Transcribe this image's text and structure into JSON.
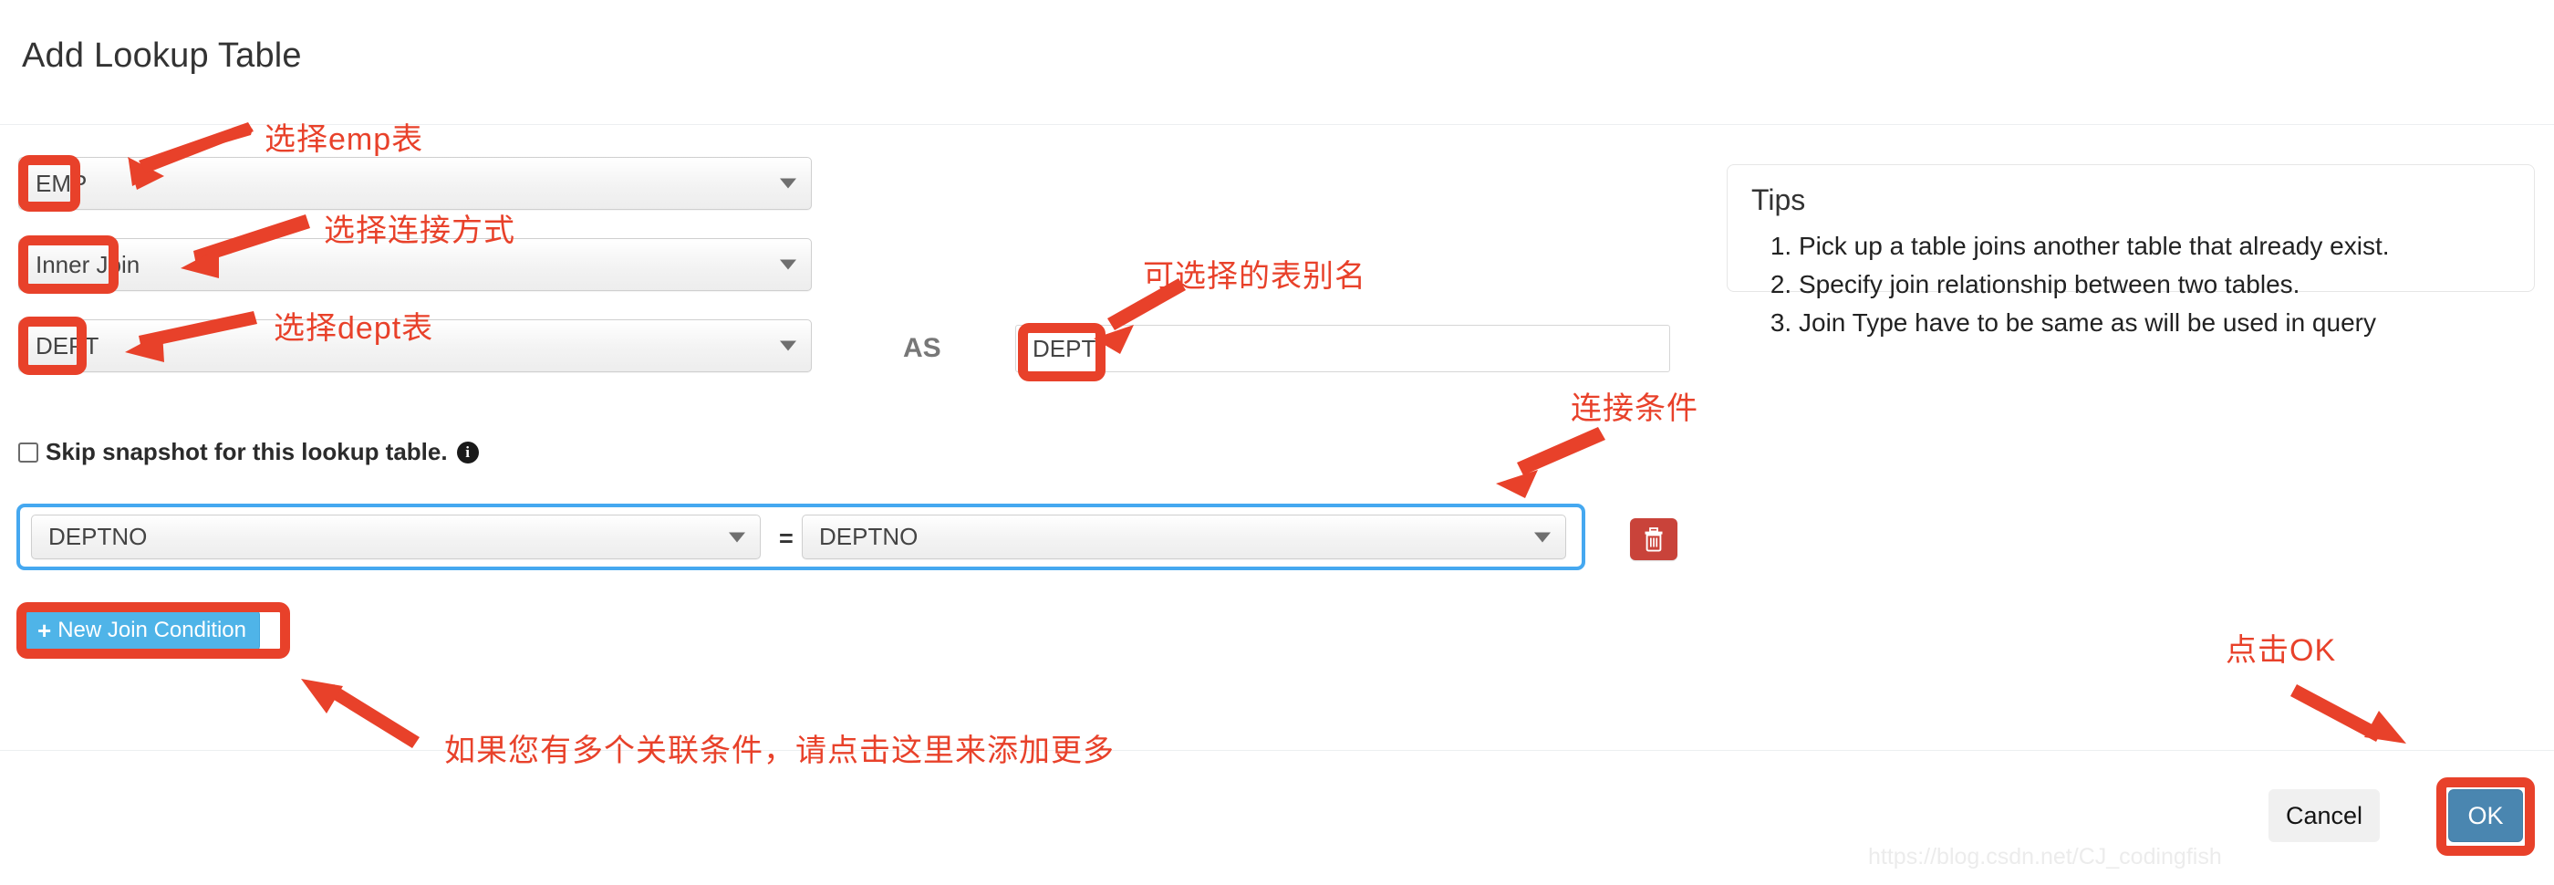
{
  "dialog": {
    "title": "Add Lookup Table"
  },
  "form": {
    "left_table_select": {
      "value": "EMP"
    },
    "join_type_select": {
      "value": "Inner Join"
    },
    "right_table_select": {
      "value": "DEPT"
    },
    "as_label": "AS",
    "alias_input": {
      "value": "DEPT",
      "placeholder": ""
    },
    "skip_snapshot": {
      "label": "Skip snapshot for this lookup table.",
      "checked": false,
      "info_glyph": "i"
    },
    "join_condition": {
      "left_column_select": {
        "value": "DEPTNO"
      },
      "operator": "=",
      "right_column_select": {
        "value": "DEPTNO"
      },
      "delete_title": "delete"
    },
    "new_join_condition_button": {
      "plus": "+",
      "label": "New Join Condition"
    }
  },
  "tips": {
    "title": "Tips",
    "items": [
      "Pick up a table joins another table that already exist.",
      "Specify join relationship between two tables.",
      "Join Type have to be same as will be used in query"
    ]
  },
  "footer": {
    "cancel_label": "Cancel",
    "ok_label": "OK"
  },
  "watermark": "https://blog.csdn.net/CJ_codingfish",
  "annotations": {
    "pick_emp_table": "选择emp表",
    "pick_join_type": "选择连接方式",
    "pick_dept_table": "选择dept表",
    "optional_alias": "可选择的表别名",
    "join_condition": "连接条件",
    "add_more_conditions": "如果您有多个关联条件，请点击这里来添加更多",
    "click_ok": "点击OK"
  },
  "colors": {
    "annotation_red": "#e8412a",
    "focus_blue": "#45a8f0",
    "primary_blue": "#4fb4e8",
    "ok_blue": "#4a86b0",
    "delete_red": "#c9433a"
  }
}
